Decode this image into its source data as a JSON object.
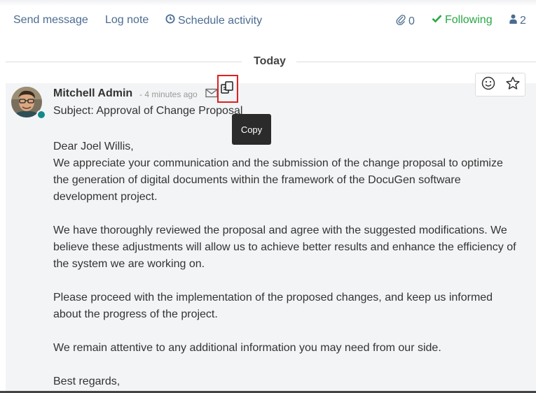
{
  "toolbar": {
    "send_message": "Send message",
    "log_note": "Log note",
    "schedule_activity": "Schedule activity",
    "attachments_count": "0",
    "following": "Following",
    "followers_count": "2"
  },
  "date_separator": "Today",
  "message": {
    "author": "Mitchell Admin",
    "time_ago": "- 4 minutes ago",
    "subject": "Subject: Approval of Change Proposal",
    "tooltip": "Copy",
    "paragraphs": [
      "Dear Joel Willis,\nWe appreciate your communication and the submission of the change proposal to optimize the generation of digital documents within the framework of the DocuGen software development project.",
      "We have thoroughly reviewed the proposal and agree with the suggested modifications. We believe these adjustments will allow us to achieve better results and enhance the efficiency of the system we are working on.",
      "Please proceed with the implementation of the proposed changes, and keep us informed about the progress of the project.",
      "We remain attentive to any additional information you may need from our side.",
      "Best regards,"
    ]
  },
  "colors": {
    "link": "#4b6c91",
    "following": "#28a745",
    "message_bg": "#f3f4f6",
    "tooltip_bg": "#2b2b2b",
    "highlight": "#e02020"
  }
}
